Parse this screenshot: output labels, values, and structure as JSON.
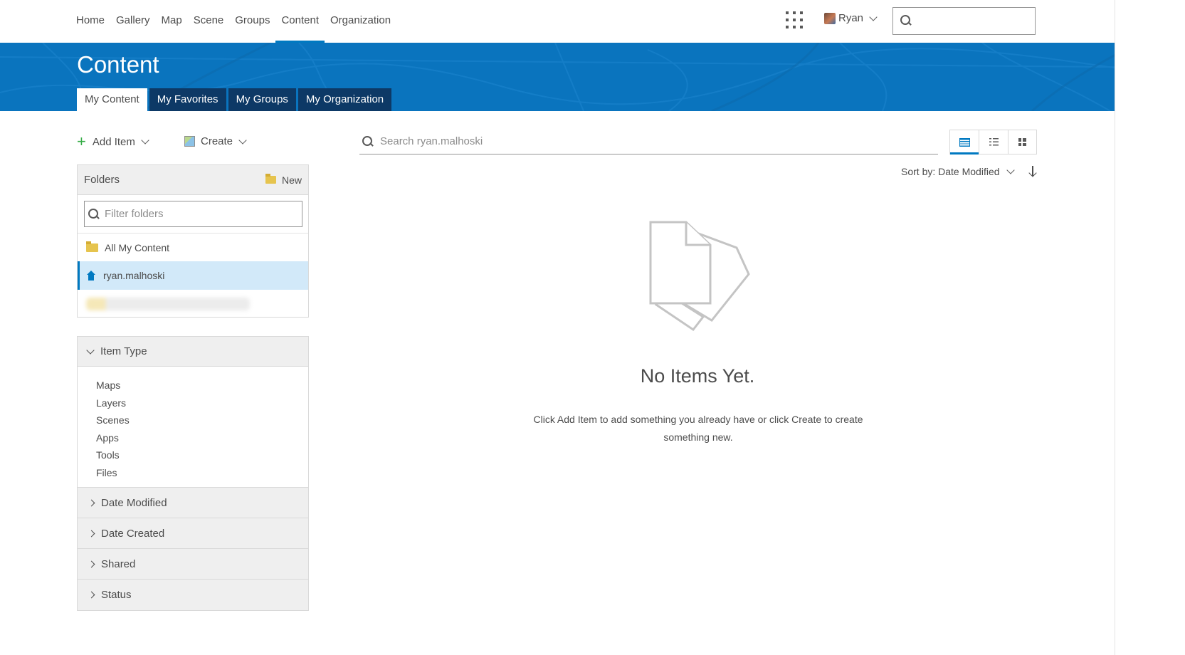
{
  "topnav": {
    "links": [
      {
        "label": "Home"
      },
      {
        "label": "Gallery"
      },
      {
        "label": "Map"
      },
      {
        "label": "Scene"
      },
      {
        "label": "Groups"
      },
      {
        "label": "Content"
      },
      {
        "label": "Organization"
      }
    ],
    "active_link": "Content",
    "user_name": "Ryan"
  },
  "banner": {
    "title": "Content",
    "tabs": [
      {
        "label": "My Content"
      },
      {
        "label": "My Favorites"
      },
      {
        "label": "My Groups"
      },
      {
        "label": "My Organization"
      }
    ],
    "active_tab": "My Content"
  },
  "toolbar": {
    "add_item_label": "Add Item",
    "create_label": "Create"
  },
  "folders": {
    "title": "Folders",
    "new_label": "New",
    "filter_placeholder": "Filter folders",
    "items": [
      {
        "label": "All My Content"
      },
      {
        "label": "ryan.malhoski"
      }
    ],
    "selected": "ryan.malhoski"
  },
  "filters": {
    "item_type": {
      "title": "Item Type",
      "expanded": true,
      "options": [
        "Maps",
        "Layers",
        "Scenes",
        "Apps",
        "Tools",
        "Files"
      ]
    },
    "sections": [
      {
        "title": "Date Modified"
      },
      {
        "title": "Date Created"
      },
      {
        "title": "Shared"
      },
      {
        "title": "Status"
      }
    ]
  },
  "main": {
    "search_placeholder": "Search ryan.malhoski",
    "view_modes": [
      "table-icon",
      "list-icon",
      "grid-icon"
    ],
    "active_view": "table-icon",
    "sort_label": "Sort by: Date Modified",
    "empty_title": "No Items Yet.",
    "empty_text": "Click Add Item to add something you already have or click Create to create something new."
  },
  "colors": {
    "accent": "#0079c1",
    "banner": "#0a74be",
    "tab_dark": "#0d3966",
    "selected_row": "#d2e9f9"
  }
}
